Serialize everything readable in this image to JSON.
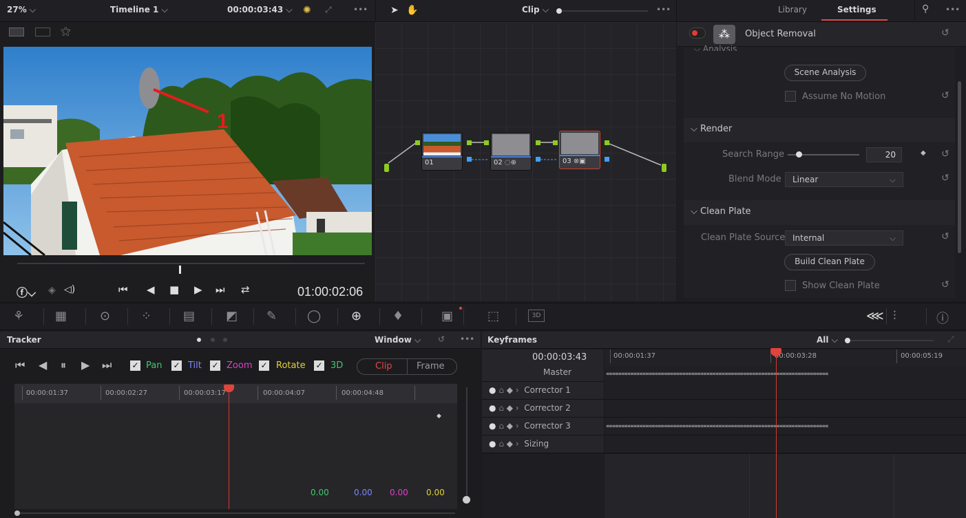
{
  "topbar": {
    "zoom": "27%",
    "timeline": "Timeline 1",
    "timecode": "00:00:03:43",
    "clip_label": "Clip",
    "library_tab": "Library",
    "settings_tab": "Settings"
  },
  "viewer": {
    "annotation_number": "1",
    "timecode": "01:00:02:06"
  },
  "nodes": [
    {
      "label": "01"
    },
    {
      "label": "02"
    },
    {
      "label": "03"
    }
  ],
  "inspector": {
    "effect_name": "Object Removal",
    "analysis_section": "Analysis",
    "scene_analysis_button": "Scene Analysis",
    "assume_no_motion": "Assume No Motion",
    "render_section": "Render",
    "search_range_label": "Search Range",
    "search_range_value": "20",
    "search_range_level": 0.15,
    "blend_mode_label": "Blend Mode",
    "blend_mode_value": "Linear",
    "clean_plate_section": "Clean Plate",
    "clean_plate_source_label": "Clean Plate Source",
    "clean_plate_source_value": "Internal",
    "build_clean_plate_button": "Build Clean Plate",
    "show_clean_plate": "Show Clean Plate"
  },
  "tracker": {
    "title": "Tracker",
    "window_label": "Window",
    "checks": [
      {
        "label": "Pan",
        "color": "#3fc96b"
      },
      {
        "label": "Tilt",
        "color": "#7b86ff"
      },
      {
        "label": "Zoom",
        "color": "#e040c8"
      },
      {
        "label": "Rotate",
        "color": "#e2d230"
      },
      {
        "label": "3D",
        "color": "#3fc96b"
      }
    ],
    "clip_mode": "Clip",
    "frame_mode": "Frame",
    "ruler": [
      "00:00:01:37",
      "00:00:02:27",
      "00:00:03:17",
      "00:00:04:07",
      "00:00:04:48"
    ],
    "values": [
      {
        "text": "0.00",
        "color": "#3fc96b"
      },
      {
        "text": "0.00",
        "color": "#7b86ff"
      },
      {
        "text": "0.00",
        "color": "#e040c8"
      },
      {
        "text": "0.00",
        "color": "#e2d230"
      }
    ]
  },
  "keyframes": {
    "title": "Keyframes",
    "filter": "All",
    "timecode": "00:00:03:43",
    "ruler": [
      "00:00:01:37",
      "00:00:03:28",
      "00:00:05:19"
    ],
    "rows": [
      {
        "label": "Master",
        "has_keys": true
      },
      {
        "label": "Corrector 1",
        "has_keys": false
      },
      {
        "label": "Corrector 2",
        "has_keys": false
      },
      {
        "label": "Corrector 3",
        "has_keys": true
      },
      {
        "label": "Sizing",
        "has_keys": false
      }
    ]
  }
}
